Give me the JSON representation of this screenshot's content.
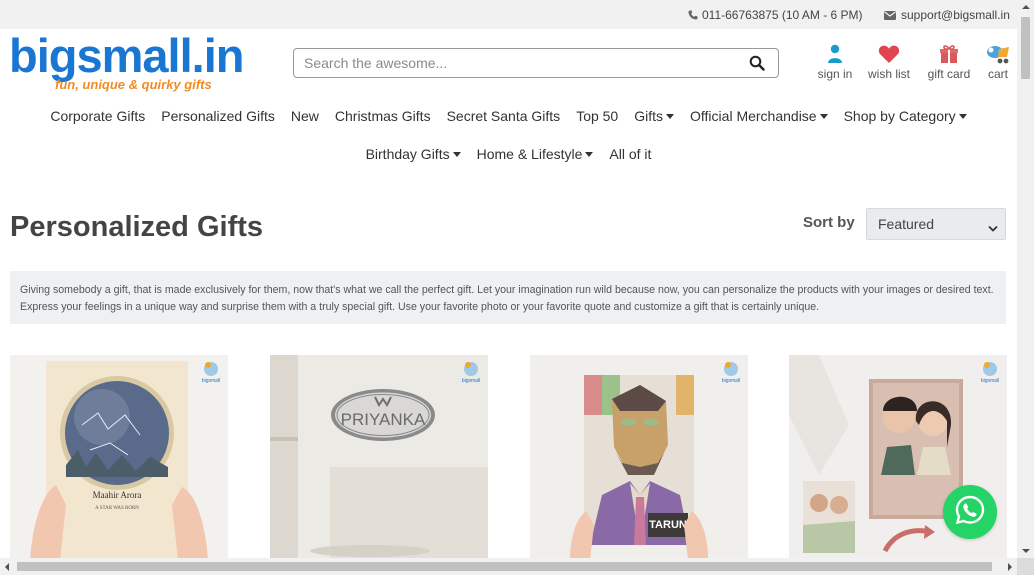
{
  "topbar": {
    "phone": "011-66763875 (10 AM - 6 PM)",
    "email": "support@bigsmall.in"
  },
  "logo": {
    "name": "bigsmall.in",
    "tagline": "fun, unique & quirky gifts"
  },
  "search": {
    "placeholder": "Search the awesome..."
  },
  "header_icons": [
    {
      "label": "sign in",
      "icon": "user-icon"
    },
    {
      "label": "wish list",
      "icon": "heart-icon"
    },
    {
      "label": "gift card",
      "icon": "gift-icon"
    },
    {
      "label": "cart",
      "icon": "cart-icon"
    }
  ],
  "nav": {
    "row1": [
      "Corporate Gifts",
      "Personalized Gifts",
      "New",
      "Christmas Gifts",
      "Secret Santa Gifts",
      "Top 50",
      "Gifts",
      "Official Merchandise",
      "Shop by Category"
    ],
    "row2": [
      "Birthday Gifts",
      "Home & Lifestyle",
      "All of it"
    ]
  },
  "page": {
    "title": "Personalized Gifts",
    "sort_label": "Sort by",
    "sort_value": "Featured",
    "description": "Giving somebody a gift, that is made exclusively for them, now that's what we call the perfect gift. Let your imagination run wild because now, you can personalize the products with your images or desired text. Express your feelings in a unique way and surprise them with a truly special gift. Use your favorite photo or your favorite quote and customize a gift that is certainly unique."
  },
  "products": [
    {
      "image": "star-map-frame",
      "name_text": "Maahir Arora",
      "sub_text": "A STAR WAS BORN"
    },
    {
      "image": "name-plate",
      "name_text": "PRIYANKA"
    },
    {
      "image": "wpap-portrait-frame",
      "name_text": "TARUN"
    },
    {
      "image": "caricature-frame"
    }
  ],
  "colors": {
    "brand_blue": "#1976d2",
    "brand_orange": "#f08c27",
    "whatsapp": "#25d366"
  }
}
